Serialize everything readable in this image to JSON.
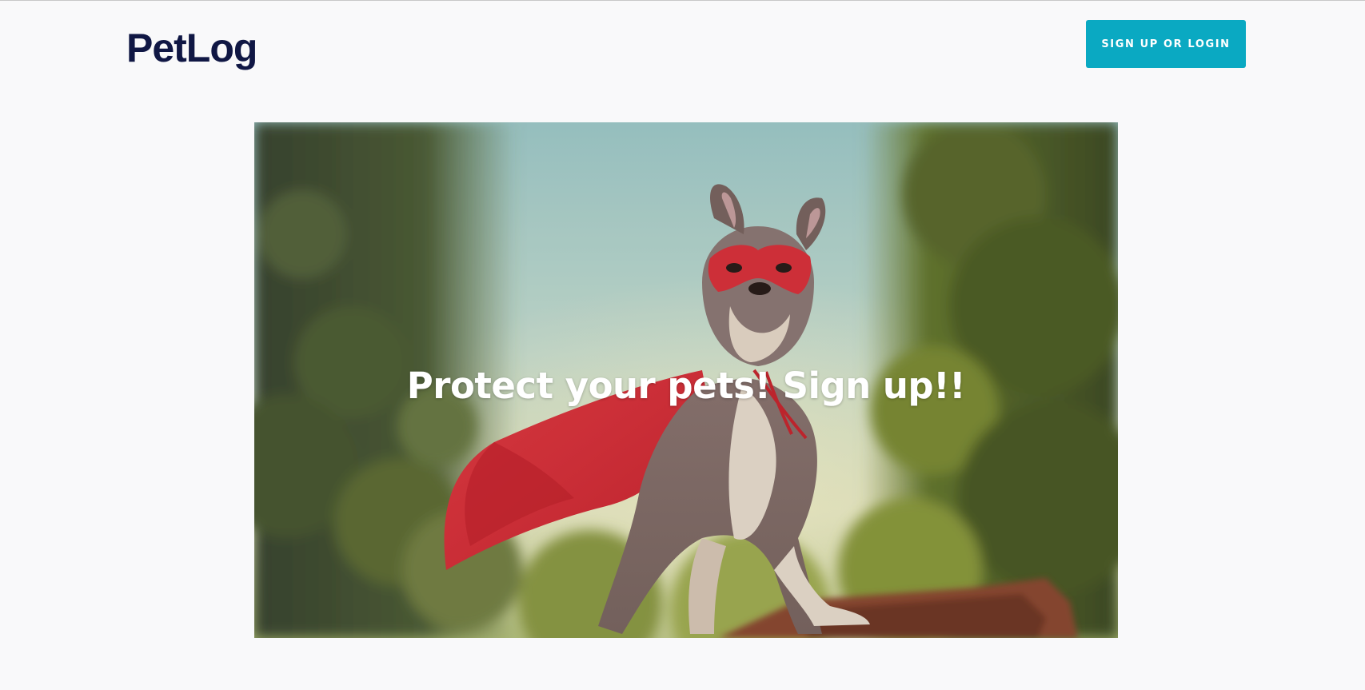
{
  "header": {
    "brand": "PetLog",
    "cta_label": "SIGN UP OR LOGIN"
  },
  "hero": {
    "title": "Protect your pets! Sign up!!",
    "image_subject": "french-bulldog-superhero-photo"
  },
  "colors": {
    "brand_text": "#101744",
    "cta_background": "#0aa9c2",
    "page_background": "#f9f9fa",
    "cape_red": "#d8323c"
  }
}
